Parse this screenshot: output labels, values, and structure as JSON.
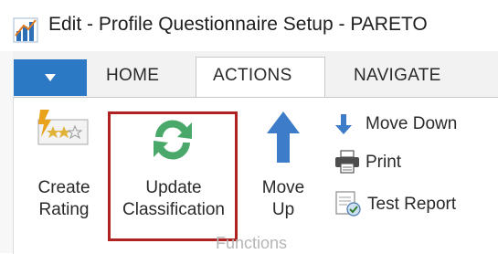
{
  "window": {
    "title": "Edit - Profile Questionnaire Setup - PARETO"
  },
  "ribbon": {
    "tabs": [
      {
        "label": "HOME",
        "active": false
      },
      {
        "label": "ACTIONS",
        "active": true
      },
      {
        "label": "NAVIGATE",
        "active": false
      }
    ],
    "group": {
      "label": "Functions",
      "buttons": {
        "create_rating": {
          "line1": "Create",
          "line2": "Rating",
          "icon": "rating-stars-icon"
        },
        "update_classification": {
          "line1": "Update",
          "line2": "Classification",
          "icon": "refresh-icon"
        },
        "move_up": {
          "line1": "Move",
          "line2": "Up",
          "icon": "arrow-up-icon"
        },
        "move_down": {
          "label": "Move Down",
          "icon": "arrow-down-icon"
        },
        "print": {
          "label": "Print",
          "icon": "printer-icon"
        },
        "test_report": {
          "label": "Test Report",
          "icon": "report-icon"
        }
      }
    }
  },
  "colors": {
    "menu_button": "#2b78c5",
    "arrow_blue": "#3d7cc8",
    "refresh_green": "#4aa86b",
    "highlight": "#b02222"
  }
}
